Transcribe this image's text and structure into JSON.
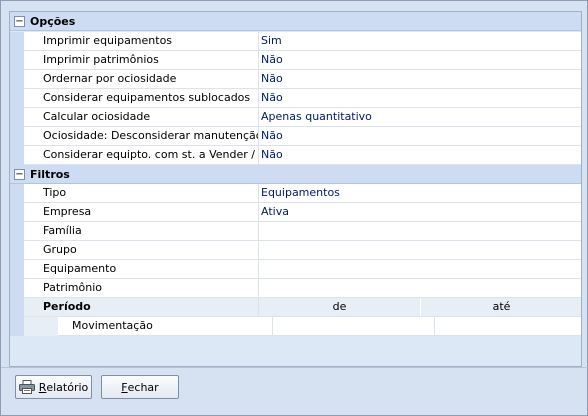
{
  "options": {
    "title": "Opções",
    "toggle": "−",
    "items": [
      {
        "label": "Imprimir equipamentos",
        "value": "Sim"
      },
      {
        "label": "Imprimir patrimônios",
        "value": "Não"
      },
      {
        "label": "Ordernar por ociosidade",
        "value": "Não"
      },
      {
        "label": "Considerar equipamentos sublocados",
        "value": "Não"
      },
      {
        "label": "Calcular ociosidade",
        "value": "Apenas quantitativo"
      },
      {
        "label": "Ociosidade: Desconsiderar manutenção",
        "value": "Não"
      },
      {
        "label": "Considerar equipto. com st. a Vender / Sucata",
        "value": "Não"
      }
    ]
  },
  "filters": {
    "title": "Filtros",
    "toggle": "−",
    "items": [
      {
        "label": "Tipo",
        "value": "Equipamentos"
      },
      {
        "label": "Empresa",
        "value": "Ativa"
      },
      {
        "label": "Família",
        "value": ""
      },
      {
        "label": "Grupo",
        "value": ""
      },
      {
        "label": "Equipamento",
        "value": ""
      },
      {
        "label": "Patrimônio",
        "value": ""
      }
    ],
    "period": {
      "label": "Período",
      "from": "de",
      "to": "até"
    },
    "movement": {
      "label": "Movimentação",
      "from": "",
      "to": ""
    }
  },
  "buttons": {
    "report": {
      "first": "R",
      "rest": "elatório",
      "icon": "printer-icon"
    },
    "close": {
      "first": "F",
      "rest": "echar"
    }
  }
}
